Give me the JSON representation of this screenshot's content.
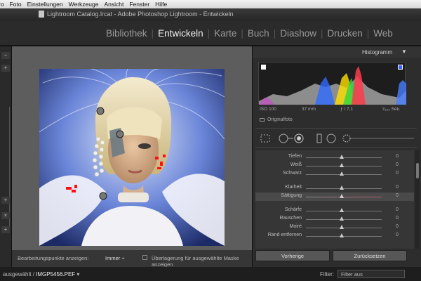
{
  "menubar": {
    "items": [
      "ro",
      "Foto",
      "Einstellungen",
      "Werkzeuge",
      "Ansicht",
      "Fenster",
      "Hilfe"
    ]
  },
  "window": {
    "title": "Lightroom Catalog.lrcat - Adobe Photoshop Lightroom - Entwickeln"
  },
  "modules": [
    "Bibliothek",
    "Entwickeln",
    "Karte",
    "Buch",
    "Diashow",
    "Drucken",
    "Web"
  ],
  "active_module": "Entwickeln",
  "histogram": {
    "title": "Histogramm",
    "iso": "ISO 100",
    "focal": "37 mm",
    "aperture": "ƒ / 7,1",
    "shutter": "¹⁄₁₆₀ Sek."
  },
  "original_photo_label": "Originalfoto",
  "adjustments": [
    {
      "label": "Tiefen",
      "value": "0"
    },
    {
      "label": "Weiß",
      "value": "0"
    },
    {
      "label": "Schwarz",
      "value": "0"
    },
    {
      "label": "Klarheit",
      "value": "0"
    },
    {
      "label": "Sättigung",
      "value": "0"
    },
    {
      "label": "Schärfe",
      "value": "0"
    },
    {
      "label": "Rauschen",
      "value": "0"
    },
    {
      "label": "Moiré",
      "value": "0"
    },
    {
      "label": "Rand entfernen",
      "value": "0"
    }
  ],
  "buttons": {
    "previous": "Vorherige",
    "reset": "Zurücksetzen"
  },
  "toolbar": {
    "edit_points_label": "Bearbeitungspunkte anzeigen:",
    "edit_points_value": "Immer ÷",
    "overlay_label": "Überlagerung für ausgewählte Maske anzeigen"
  },
  "filmstrip": {
    "selected_prefix": "ausgewählt",
    "filename": "IMGP5456.PEF"
  },
  "filter": {
    "label": "Filter:",
    "value": "Filter aus"
  }
}
